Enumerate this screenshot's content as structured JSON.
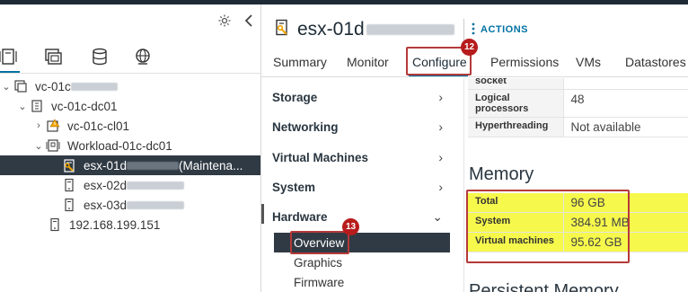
{
  "inventory": {
    "tools": {
      "settings_icon": "gear-icon",
      "collapse_icon": "chevron-left-icon"
    },
    "tabs": [
      {
        "name": "hosts-and-clusters",
        "icon": "hosts-icon"
      },
      {
        "name": "vms-and-templates",
        "icon": "vms-icon"
      },
      {
        "name": "storage",
        "icon": "database-icon"
      },
      {
        "name": "networking",
        "icon": "network-icon"
      }
    ],
    "tree": [
      {
        "label": "vc-01c",
        "expanded": true,
        "icon": "vcenter-icon"
      },
      {
        "label": "vc-01c-dc01",
        "expanded": true,
        "icon": "datacenter-icon"
      },
      {
        "label": "vc-01c-cl01",
        "expanded": false,
        "icon": "cluster-warning-icon"
      },
      {
        "label": "Workload-01c-dc01",
        "expanded": true,
        "icon": "cluster-icon"
      },
      {
        "label": "esx-01d",
        "suffix": "(Maintena...",
        "icon": "host-maintenance-icon",
        "selected": true
      },
      {
        "label": "esx-02d",
        "icon": "host-icon"
      },
      {
        "label": "esx-03d",
        "icon": "host-icon"
      },
      {
        "label": "192.168.199.151",
        "icon": "host-icon"
      }
    ]
  },
  "header": {
    "host_title": "esx-01d",
    "actions_label": "ACTIONS"
  },
  "tabs": [
    {
      "label": "Summary"
    },
    {
      "label": "Monitor"
    },
    {
      "label": "Configure",
      "active": true
    },
    {
      "label": "Permissions"
    },
    {
      "label": "VMs"
    },
    {
      "label": "Datastores"
    }
  ],
  "badges": {
    "configure": "12",
    "overview": "13"
  },
  "configure_nav": {
    "sections": [
      {
        "label": "Storage",
        "arrow": "›"
      },
      {
        "label": "Networking",
        "arrow": "›"
      },
      {
        "label": "Virtual Machines",
        "arrow": "›"
      },
      {
        "label": "System",
        "arrow": "›"
      },
      {
        "label": "Hardware",
        "arrow": "⌄"
      }
    ],
    "hardware_items": [
      {
        "label": "Overview",
        "selected": true
      },
      {
        "label": "Graphics"
      },
      {
        "label": "Firmware"
      }
    ]
  },
  "processors_table": [
    {
      "key": "socket",
      "value": ""
    },
    {
      "key": "Logical processors",
      "value": "48"
    },
    {
      "key": "Hyperthreading",
      "value": "Not available"
    }
  ],
  "memory": {
    "title": "Memory",
    "rows": [
      {
        "key": "Total",
        "value": "96 GB"
      },
      {
        "key": "System",
        "value": "384.91 MB"
      },
      {
        "key": "Virtual machines",
        "value": "95.62 GB"
      }
    ]
  },
  "persistent_memory": {
    "title": "Persistent Memory"
  },
  "colors": {
    "accent": "#0072a3",
    "highlight": "#f6f94b",
    "callout": "#b53939",
    "selected_row": "#303a44"
  }
}
